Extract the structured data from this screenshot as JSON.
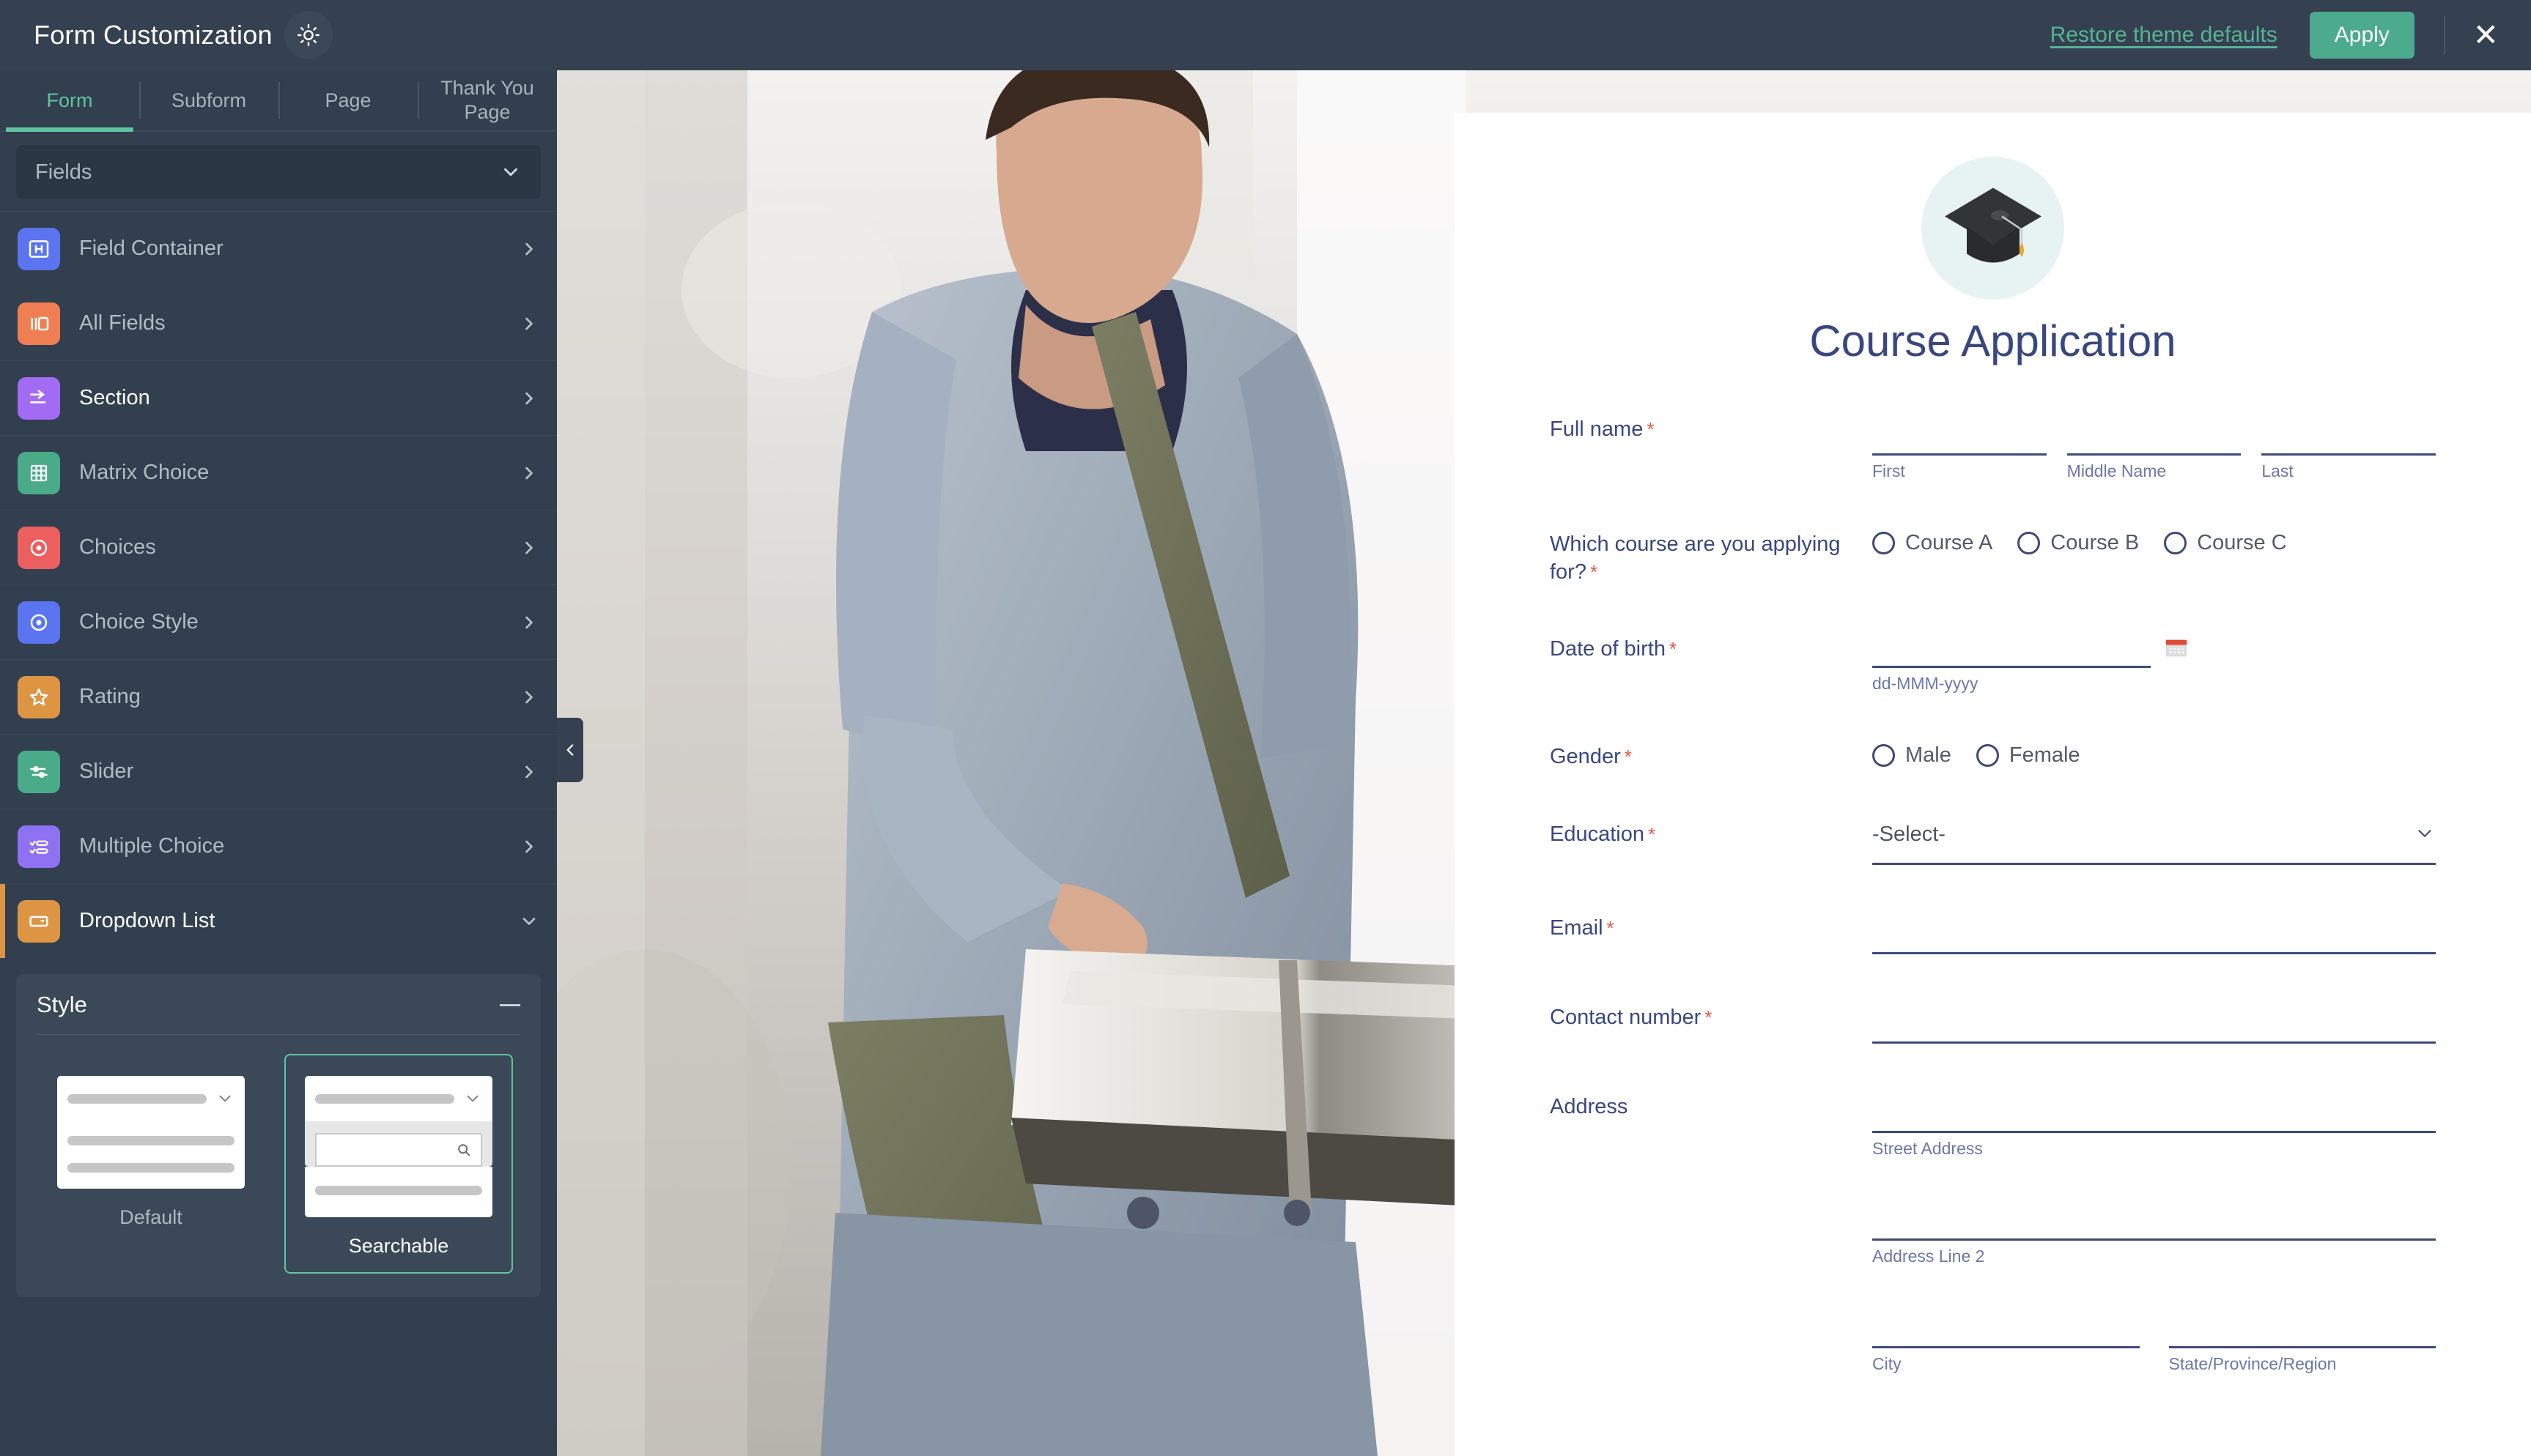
{
  "header": {
    "title": "Form Customization",
    "theme_icon": "sun-icon",
    "restore_label": "Restore theme defaults",
    "apply_label": "Apply",
    "close_icon": "close-icon",
    "bg": "#354150",
    "accent": "#4bab8c"
  },
  "tabs": [
    {
      "label": "Form",
      "active": true
    },
    {
      "label": "Subform",
      "active": false
    },
    {
      "label": "Page",
      "active": false
    },
    {
      "label": "Thank You Page",
      "active": false
    }
  ],
  "sidebar": {
    "selector": {
      "value": "Fields",
      "icon": "chevron-down-icon"
    },
    "items": [
      {
        "label": "Field Container",
        "icon": "field-container-icon",
        "color": "#5b74ef",
        "state": "normal",
        "arrow": "chevron-right-icon"
      },
      {
        "label": "All Fields",
        "icon": "all-fields-icon",
        "color": "#ef7f52",
        "state": "normal",
        "arrow": "chevron-right-icon"
      },
      {
        "label": "Section",
        "icon": "section-icon",
        "color": "#a26bf4",
        "state": "sel",
        "arrow": "chevron-right-icon"
      },
      {
        "label": "Matrix Choice",
        "icon": "matrix-grid-icon",
        "color": "#49ab88",
        "state": "normal",
        "arrow": "chevron-right-icon"
      },
      {
        "label": "Choices",
        "icon": "radio-circle-icon",
        "color": "#ec5f5f",
        "state": "normal",
        "arrow": "chevron-right-icon"
      },
      {
        "label": "Choice Style",
        "icon": "radio-circle-icon",
        "color": "#5b74ef",
        "state": "normal",
        "arrow": "chevron-right-icon"
      },
      {
        "label": "Rating",
        "icon": "star-icon",
        "color": "#dd9544",
        "state": "normal",
        "arrow": "chevron-right-icon"
      },
      {
        "label": "Slider",
        "icon": "sliders-icon",
        "color": "#49ab88",
        "state": "normal",
        "arrow": "chevron-right-icon"
      },
      {
        "label": "Multiple Choice",
        "icon": "checklist-icon",
        "color": "#8e72f2",
        "state": "normal",
        "arrow": "chevron-right-icon"
      },
      {
        "label": "Dropdown List",
        "icon": "dropdown-icon",
        "color": "#dd9544",
        "state": "active",
        "arrow": "chevron-down-icon"
      }
    ],
    "style_panel": {
      "title": "Style",
      "collapse_icon": "minus-icon",
      "options": [
        {
          "label": "Default",
          "selected": false
        },
        {
          "label": "Searchable",
          "selected": true,
          "search_icon": "search-icon"
        }
      ]
    },
    "collapse_handle_icon": "chevron-left-icon"
  },
  "form": {
    "logo_icon": "graduation-cap-icon",
    "title": "Course Application",
    "title_color": "#38487f",
    "fields": [
      {
        "label": "Full name",
        "required": true,
        "type": "name",
        "subfields": [
          {
            "sub": "First",
            "value": ""
          },
          {
            "sub": "Middle Name",
            "value": ""
          },
          {
            "sub": "Last",
            "value": ""
          }
        ]
      },
      {
        "label": "Which course are you applying for?",
        "required": true,
        "type": "radio",
        "options": [
          "Course A",
          "Course B",
          "Course C"
        ]
      },
      {
        "label": "Date of birth",
        "required": true,
        "type": "date",
        "value": "",
        "sub": "dd-MMM-yyyy",
        "icon": "calendar-icon"
      },
      {
        "label": "Gender",
        "required": true,
        "type": "radio",
        "options": [
          "Male",
          "Female"
        ]
      },
      {
        "label": "Education",
        "required": true,
        "type": "select",
        "value": "-Select-",
        "icon": "chevron-down-icon"
      },
      {
        "label": "Email",
        "required": true,
        "type": "text",
        "value": ""
      },
      {
        "label": "Contact number",
        "required": true,
        "type": "text",
        "value": ""
      },
      {
        "label": "Address",
        "required": false,
        "type": "address",
        "lines": [
          {
            "sub": "Street Address",
            "value": ""
          },
          {
            "sub": "Address Line 2",
            "value": ""
          }
        ],
        "pair": [
          {
            "sub": "City",
            "value": ""
          },
          {
            "sub": "State/Province/Region",
            "value": ""
          }
        ]
      }
    ]
  }
}
